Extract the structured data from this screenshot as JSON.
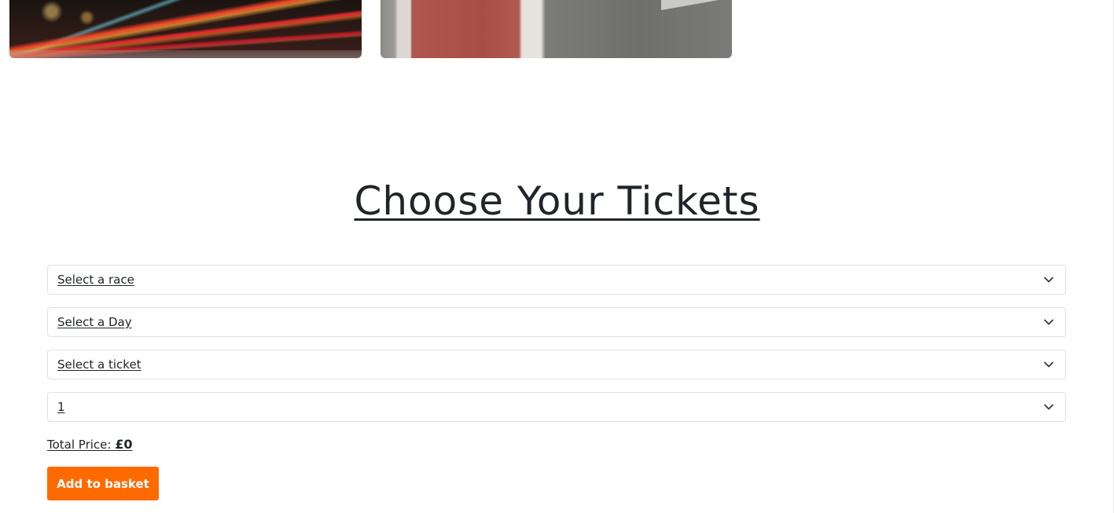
{
  "heading": "Choose Your Tickets",
  "selects": {
    "race": "Select a race",
    "day": "Select a Day",
    "ticket": "Select a ticket",
    "quantity": "1"
  },
  "total": {
    "label": "Total Price:",
    "amount": "£0"
  },
  "add_button_label": "Add to basket",
  "icons": {
    "dropdown": "chevron-down-icon"
  },
  "colors": {
    "accent": "#ff6a00",
    "text": "#212529",
    "border": "#dee2e6"
  }
}
